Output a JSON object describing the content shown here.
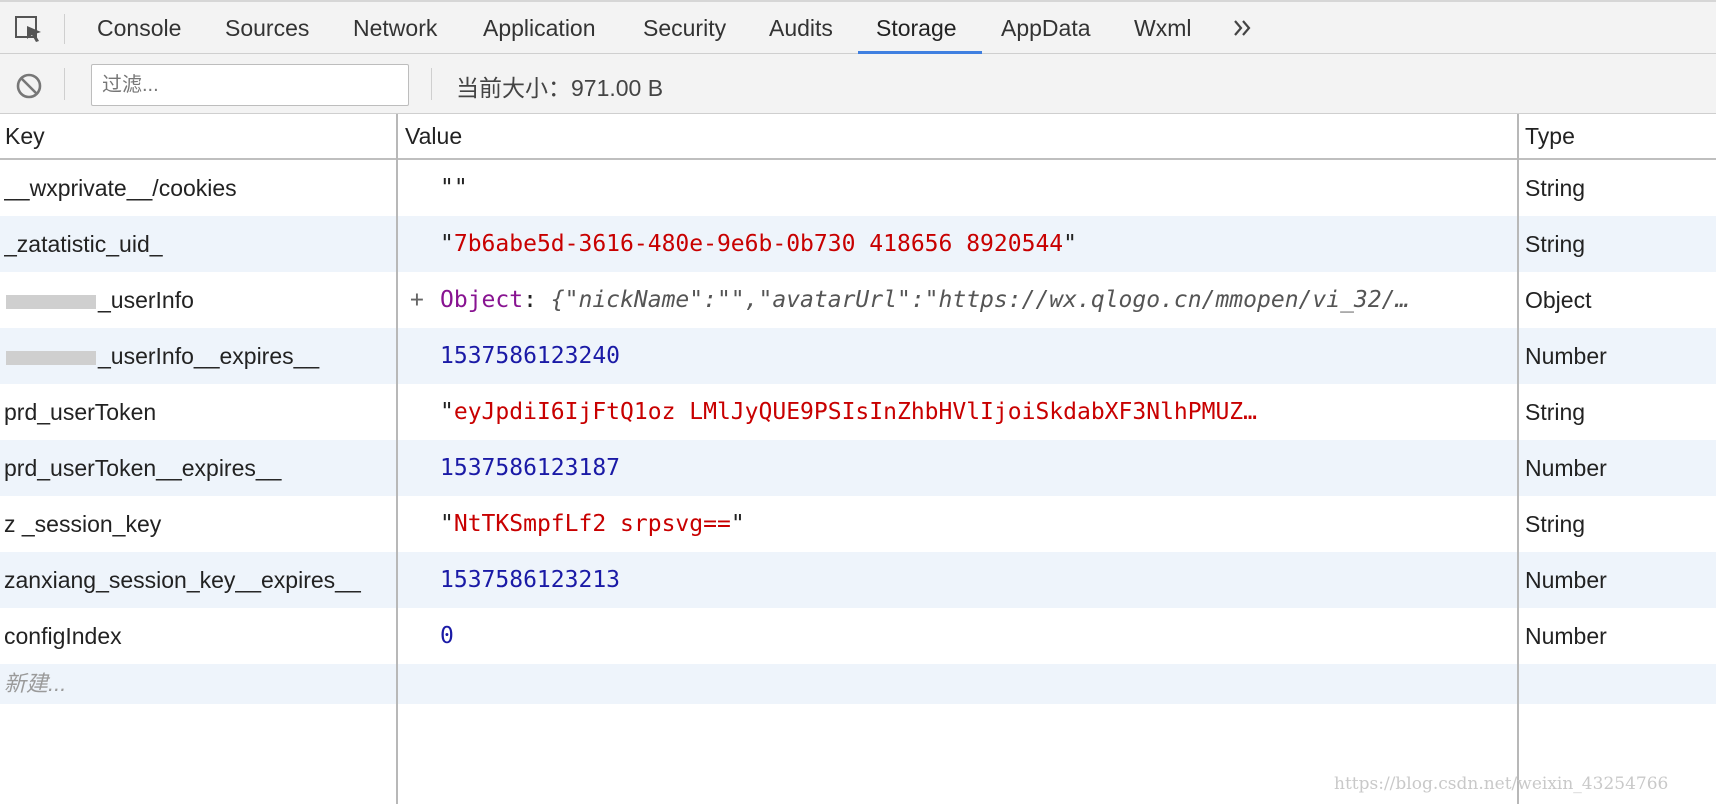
{
  "tabs": [
    {
      "label": "Console"
    },
    {
      "label": "Sources"
    },
    {
      "label": "Network"
    },
    {
      "label": "Application"
    },
    {
      "label": "Security"
    },
    {
      "label": "Audits"
    },
    {
      "label": "Storage",
      "active": true
    },
    {
      "label": "AppData"
    },
    {
      "label": "Wxml"
    }
  ],
  "toolbar": {
    "filter_placeholder": "过滤...",
    "size_label": "当前大小：971.00 B"
  },
  "table": {
    "headers": {
      "key": "Key",
      "value": "Value",
      "type": "Type"
    },
    "rows": [
      {
        "key": "__wxprivate__/cookies",
        "value": "\"\"",
        "type": "String"
      },
      {
        "key": "_zatatistic_uid_",
        "value": "7b6abe5d-3616-480e-9e6b-0b730 418656 8920544",
        "type": "String"
      },
      {
        "key": "_userInfo",
        "value_label": "Object",
        "value": "{\"nickName\":\"\",\"avatarUrl\":\"https://wx.qlogo.cn/mmopen/vi_32/…",
        "type": "Object"
      },
      {
        "key": "_userInfo__expires__",
        "value": "1537586123240",
        "type": "Number"
      },
      {
        "key": "prd_userToken",
        "value": "eyJpdiI6IjFtQ1oz LMlJyQUE9PSIsInZhbHVlIjoiSkdabXF3NlhPMUZ…",
        "type": "String"
      },
      {
        "key": "prd_userToken__expires__",
        "value": "1537586123187",
        "type": "Number"
      },
      {
        "key": "z _session_key",
        "value": "NtTKSmpfLf2 srpsvg==",
        "type": "String"
      },
      {
        "key": "zanxiang_session_key__expires__",
        "value": "1537586123213",
        "type": "Number"
      },
      {
        "key": "configIndex",
        "value": "0",
        "type": "Number"
      }
    ],
    "new_row_placeholder": "新建..."
  },
  "watermark": "https://blog.csdn.net/weixin_43254766"
}
